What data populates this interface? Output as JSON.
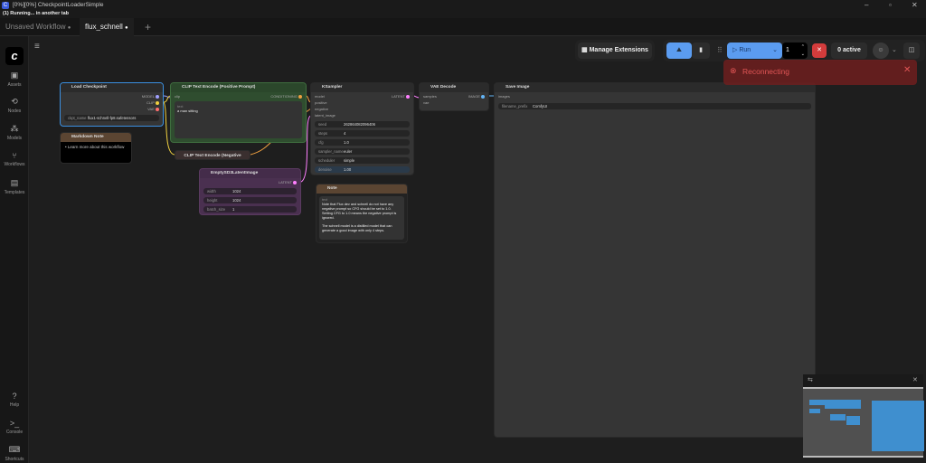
{
  "window": {
    "title": "[0%][0%] CheckpointLoaderSimple",
    "status": "(1) Running... in another tab"
  },
  "tabs": [
    {
      "label": "Unsaved Workflow"
    },
    {
      "label": "flux_schnell"
    }
  ],
  "sidebar": {
    "items": [
      {
        "label": "Assets"
      },
      {
        "label": "Nodes"
      },
      {
        "label": "Models"
      },
      {
        "label": "Workflows"
      },
      {
        "label": "Templates"
      }
    ],
    "bottom": [
      {
        "label": "Help"
      },
      {
        "label": "Console"
      },
      {
        "label": "Shortcuts"
      }
    ]
  },
  "toolbar": {
    "manage_extensions": "Manage Extensions",
    "run": "Run",
    "queue_count": "1",
    "active": "0 active"
  },
  "toast": {
    "message": "Reconnecting",
    "color": "#e05555"
  },
  "nodes": {
    "load_checkpoint": {
      "title": "Load Checkpoint",
      "outputs": [
        "MODEL",
        "CLIP",
        "VAE"
      ],
      "ckpt_label": "ckpt_name",
      "ckpt_value": "flux1-schnell-fp8.safetensors"
    },
    "markdown_note": {
      "title": "Markdown Note",
      "text": "Learn more about this workflow"
    },
    "clip_pos": {
      "title": "CLIP Text Encode (Positive Prompt)",
      "input": "clip",
      "output": "CONDITIONING",
      "text_label": "text",
      "text_value": "a man sitting"
    },
    "clip_neg": {
      "title": "CLIP Text Encode (Negative Prompt)"
    },
    "ksampler": {
      "title": "KSampler",
      "inputs": [
        "model",
        "positive",
        "negative",
        "latent_image"
      ],
      "output": "LATENT",
      "widgets": [
        {
          "label": "seed",
          "value": "262864082096406"
        },
        {
          "label": "steps",
          "value": "4"
        },
        {
          "label": "cfg",
          "value": "1.0"
        },
        {
          "label": "sampler_name",
          "value": "euler"
        },
        {
          "label": "scheduler",
          "value": "simple"
        },
        {
          "label": "denoise",
          "value": "1.00"
        }
      ]
    },
    "vae_decode": {
      "title": "VAE Decode",
      "inputs": [
        "samples",
        "vae"
      ],
      "output": "IMAGE"
    },
    "save_image": {
      "title": "Save Image",
      "input": "images",
      "prefix_label": "filename_prefix",
      "prefix_value": "ComfyUI"
    },
    "empty_latent": {
      "title": "EmptySD3LatentImage",
      "output": "LATENT",
      "widgets": [
        {
          "label": "width",
          "value": "1024"
        },
        {
          "label": "height",
          "value": "1024"
        },
        {
          "label": "batch_size",
          "value": "1"
        }
      ]
    },
    "note": {
      "title": "Note",
      "label": "text",
      "p1": "Note that Flux dev and schnell do not have any negative prompt so CFG should be set to 1.0. Setting CFG to 1.0 means the negative prompt is ignored.",
      "p2": "The schnell model is a distilled model that can generate a good image with only 4 steps."
    }
  }
}
